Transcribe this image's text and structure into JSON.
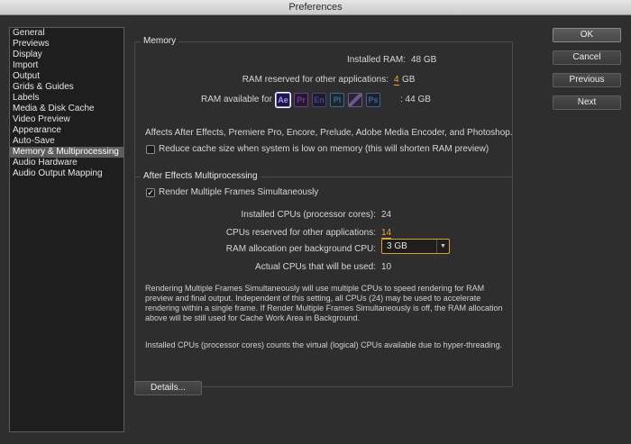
{
  "window": {
    "title": "Preferences"
  },
  "sidebar": {
    "items": [
      {
        "label": "General"
      },
      {
        "label": "Previews"
      },
      {
        "label": "Display"
      },
      {
        "label": "Import"
      },
      {
        "label": "Output"
      },
      {
        "label": "Grids & Guides"
      },
      {
        "label": "Labels"
      },
      {
        "label": "Media & Disk Cache"
      },
      {
        "label": "Video Preview"
      },
      {
        "label": "Appearance"
      },
      {
        "label": "Auto-Save"
      },
      {
        "label": "Memory & Multiprocessing"
      },
      {
        "label": "Audio Hardware"
      },
      {
        "label": "Audio Output Mapping"
      }
    ],
    "selected": "Memory & Multiprocessing"
  },
  "memory": {
    "title": "Memory",
    "installed_ram_label": "Installed RAM:",
    "installed_ram_value": "48 GB",
    "reserved_label": "RAM reserved for other applications:",
    "reserved_value": "4",
    "reserved_unit": "GB",
    "available_label": "RAM available for",
    "available_value": ":  44 GB",
    "apps": [
      {
        "abbr": "Ae",
        "icon": "after-effects-icon",
        "color": "#9999ff",
        "bg": "#1f1740",
        "active": true
      },
      {
        "abbr": "Pr",
        "icon": "premiere-pro-icon",
        "color": "#6a3f8f",
        "bg": "#26192f",
        "active": false
      },
      {
        "abbr": "En",
        "icon": "encore-icon",
        "color": "#48417a",
        "bg": "#1e1c2c",
        "active": false
      },
      {
        "abbr": "Pl",
        "icon": "prelude-icon",
        "color": "#3e6a8a",
        "bg": "#1a2630",
        "active": false
      },
      {
        "abbr": "",
        "icon": "media-encoder-icon",
        "color": "#6a5a8a",
        "bg": "#2a2438",
        "active": false
      },
      {
        "abbr": "Ps",
        "icon": "photoshop-icon",
        "color": "#4a5e88",
        "bg": "#1a2232",
        "active": false
      }
    ],
    "affects_note": "Affects After Effects, Premiere Pro, Encore, Prelude, Adobe Media Encoder, and Photoshop.",
    "reduce_cache_label": "Reduce cache size when system is low on memory (this will shorten RAM preview)",
    "reduce_cache_checked": false
  },
  "multiprocessing": {
    "title": "After Effects Multiprocessing",
    "render_multi_label": "Render Multiple Frames Simultaneously",
    "render_multi_checked": true,
    "installed_cpus_label": "Installed CPUs (processor cores):",
    "installed_cpus_value": "24",
    "reserved_cpus_label": "CPUs reserved for other applications:",
    "reserved_cpus_value": "14",
    "ram_alloc_label": "RAM allocation per background CPU:",
    "ram_alloc_value": "3 GB",
    "actual_cpus_label": "Actual CPUs that will be used:",
    "actual_cpus_value": "10",
    "note1": "Rendering Multiple Frames Simultaneously will use multiple CPUs to speed rendering for RAM preview and final output. Independent of this setting, all CPUs (24) may be used to accelerate rendering within a single frame. If Render Multiple Frames Simultaneously is off, the RAM allocation above will be still used for Cache Work Area in Background.",
    "note2": "Installed CPUs (processor cores) counts the virtual (logical) CPUs available due to hyper-threading."
  },
  "buttons": {
    "ok": "OK",
    "cancel": "Cancel",
    "previous": "Previous",
    "next": "Next",
    "details": "Details..."
  }
}
